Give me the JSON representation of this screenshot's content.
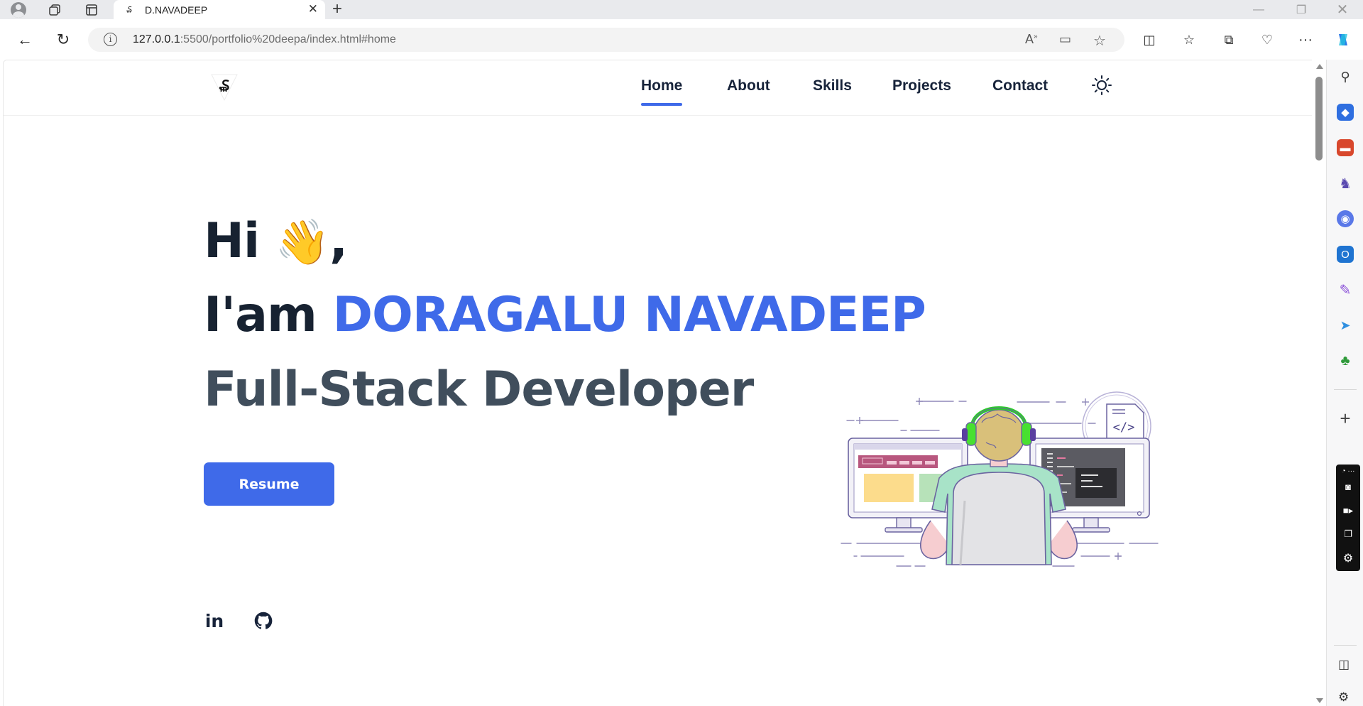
{
  "browser": {
    "tab_title": "D.NAVADEEP",
    "url_host": "127.0.0.1",
    "url_rest": ":5500/portfolio%20deepa/index.html#home"
  },
  "site": {
    "nav": {
      "items": [
        {
          "label": "Home",
          "active": true
        },
        {
          "label": "About",
          "active": false
        },
        {
          "label": "Skills",
          "active": false
        },
        {
          "label": "Projects",
          "active": false
        },
        {
          "label": "Contact",
          "active": false
        }
      ]
    },
    "hero": {
      "greeting": "Hi",
      "wave": "👋",
      "comma": ",",
      "intro": "I'am",
      "name": "DORAGALU NAVADEEP",
      "role": "Full-Stack Developer",
      "resume_label": "Resume",
      "linkedin_label": "in"
    }
  },
  "colors": {
    "accent": "#3f6ae9",
    "heading": "#172231",
    "subheading": "#404e5c"
  }
}
